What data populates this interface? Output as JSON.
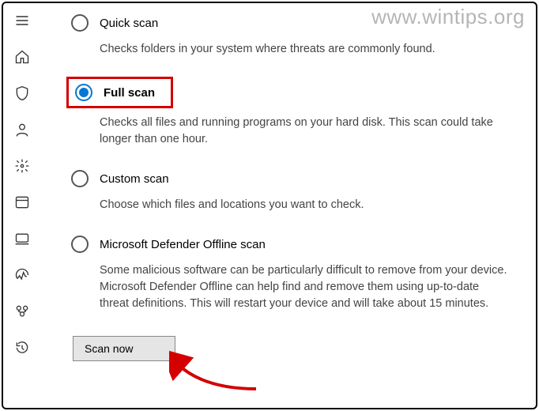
{
  "watermark": "www.wintips.org",
  "options": {
    "quick": {
      "title": "Quick scan",
      "desc": "Checks folders in your system where threats are commonly found."
    },
    "full": {
      "title": "Full scan",
      "desc": "Checks all files and running programs on your hard disk. This scan could take longer than one hour."
    },
    "custom": {
      "title": "Custom scan",
      "desc": "Choose which files and locations you want to check."
    },
    "offline": {
      "title": "Microsoft Defender Offline scan",
      "desc": "Some malicious software can be particularly difficult to remove from your device. Microsoft Defender Offline can help find and remove them using up-to-date threat definitions. This will restart your device and will take about 15 minutes."
    }
  },
  "buttons": {
    "scan_now": "Scan now"
  },
  "selected_option": "full"
}
